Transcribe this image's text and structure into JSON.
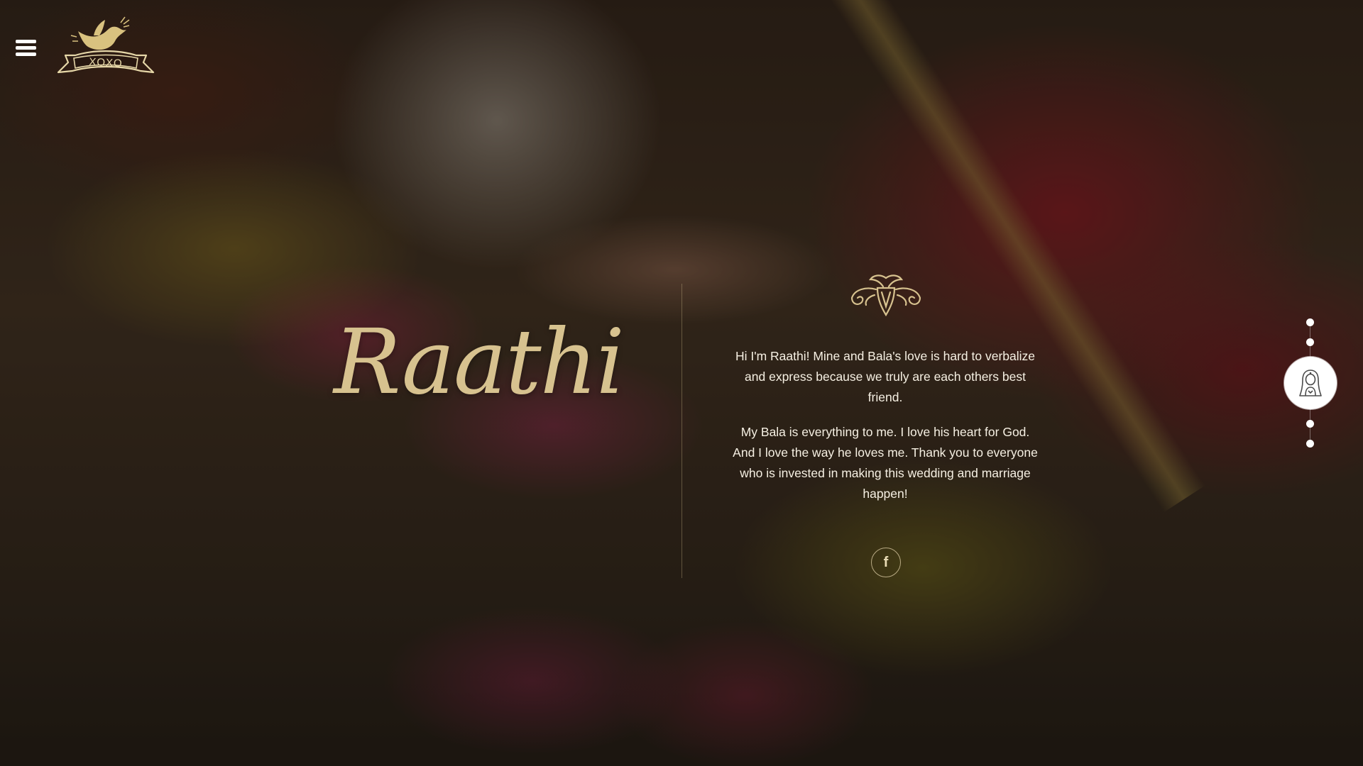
{
  "header": {
    "menu_icon": "hamburger-icon",
    "logo_icon": "dove-banner-logo",
    "logo_text": "XOXO"
  },
  "hero": {
    "name": "Raathi",
    "crest_icon": "ornamental-crest-icon",
    "bio": [
      "Hi I'm Raathi! Mine and Bala's love is hard to verbalize and express because we truly are each others best friend.",
      "My Bala is everything to me. I love his heart for God. And I love the way he loves me. Thank you to everyone who is invested in making this wedding and marriage happen!"
    ],
    "social_icon": "facebook-icon",
    "social_label": "f"
  },
  "section_nav": {
    "dot_count": 5,
    "active_index": 2,
    "active_icon": "bride-icon"
  },
  "colors": {
    "accent_gold": "#d7c28f",
    "text_light": "#f6f0e3",
    "nav_dot": "#ffffff"
  }
}
